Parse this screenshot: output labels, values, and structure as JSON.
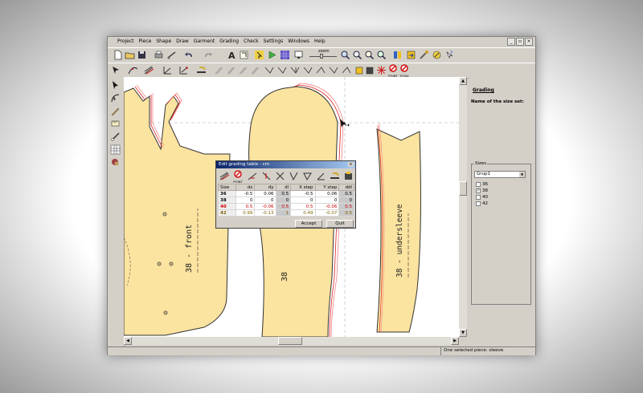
{
  "menu": [
    "Project",
    "Piece",
    "Shape",
    "Draw",
    "Garment",
    "Grading",
    "Check",
    "Settings",
    "Windows",
    "Help"
  ],
  "window_buttons": [
    "_",
    "▫",
    "×"
  ],
  "toolbar1": {
    "zoom_label": "zoom",
    "icons": [
      "new-file-icon",
      "open-folder-icon",
      "save-icon",
      "print-icon",
      "plotter-icon",
      "undo-icon",
      "redo-icon",
      "text-icon",
      "fit-icon",
      "select-icon",
      "play-icon",
      "grid-icon",
      "screen-icon",
      "zoom-in-icon",
      "zoom-out-icon",
      "zoom-piece-icon",
      "zoom-all-icon",
      "library-icon",
      "export-icon",
      "tools-icon",
      "special-icon",
      "help-icon"
    ]
  },
  "toolbar2": {
    "point_label": "POINT",
    "point_label2": "POINT",
    "total_label": "TOTAL",
    "icons": [
      "pointer-icon",
      "curve-tool-icon",
      "grading-tool-icon",
      "line-tool-icon",
      "angle-tool-icon",
      "measure-tool-icon"
    ]
  },
  "left_tools": [
    "arrow-icon",
    "bezier-icon",
    "pencil-icon",
    "ruler-icon",
    "knife-icon",
    "grid-tool-icon",
    "paint-icon"
  ],
  "pieces": [
    {
      "label": "38 - front"
    },
    {
      "label": "38"
    },
    {
      "label": "38 - undersleeve"
    }
  ],
  "dialog": {
    "title": "Edit grading table - cm",
    "close": "x",
    "point_label": "POINT",
    "headers": [
      "Size",
      "dx",
      "dy",
      "dl",
      "X step",
      "Y step",
      "ddl"
    ],
    "rows": [
      {
        "size": "36",
        "dx": "-0.5",
        "dy": "0.06",
        "dl": "0.5",
        "xs": "-0.5",
        "ys": "0.06",
        "ddl": "0.5",
        "color": "#000000"
      },
      {
        "size": "38",
        "dx": "0",
        "dy": "0",
        "dl": "0",
        "xs": "0",
        "ys": "0",
        "ddl": "0",
        "color": "#000000"
      },
      {
        "size": "40",
        "dx": "0.5",
        "dy": "-0.06",
        "dl": "0.5",
        "xs": "0.5",
        "ys": "-0.06",
        "ddl": "0.5",
        "color": "#cc0000"
      },
      {
        "size": "42",
        "dx": "0.99",
        "dy": "-0.13",
        "dl": "1",
        "xs": "0.49",
        "ys": "-0.07",
        "ddl": "0.5",
        "color": "#806000"
      }
    ],
    "accept": "Accept",
    "quit": "Quit"
  },
  "right_panel": {
    "title": "Grading",
    "subtitle": "Name of the size set:",
    "sizes_group": "Sizes",
    "sizes_select": "Grup1",
    "sizes": [
      {
        "label": "36",
        "checked": false
      },
      {
        "label": "38",
        "checked": true
      },
      {
        "label": "40",
        "checked": false
      },
      {
        "label": "42",
        "checked": false
      }
    ]
  },
  "status": "One selected piece: sleeve",
  "colors": {
    "piece_fill": "#fbe3a0",
    "outline": "#333333",
    "grade_red": "#dd2222",
    "grade_pink": "#f08080",
    "accent": "#0a246a"
  }
}
